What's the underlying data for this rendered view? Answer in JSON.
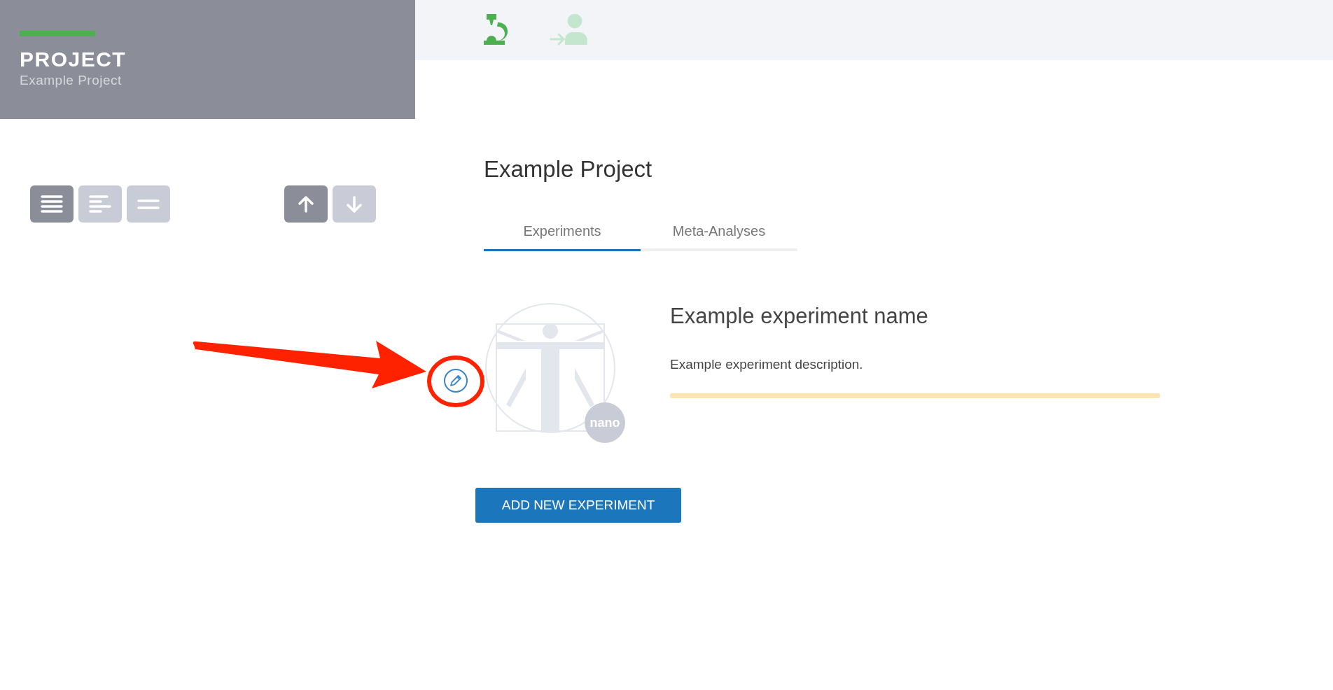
{
  "sidebar": {
    "heading": "PROJECT",
    "subheading": "Example Project"
  },
  "nav": [
    {
      "kind": "microscope",
      "selected": true
    },
    {
      "kind": "person",
      "selected": false
    }
  ],
  "layout_buttons": [
    {
      "kind": "full",
      "selected": true
    },
    {
      "kind": "left",
      "selected": false
    },
    {
      "kind": "compact",
      "selected": false
    }
  ],
  "sort_buttons": [
    {
      "kind": "up",
      "selected": true
    },
    {
      "kind": "down",
      "selected": false
    }
  ],
  "page_title": "Example Project",
  "tabs": [
    {
      "label": "Experiments",
      "selected": true
    },
    {
      "label": "Meta-Analyses",
      "selected": false
    }
  ],
  "experiments": [
    {
      "name": "Example experiment name",
      "description": "Example experiment description.",
      "badge": "nano",
      "level": 1
    }
  ],
  "add_button": "ADD NEW EXPERIMENT"
}
